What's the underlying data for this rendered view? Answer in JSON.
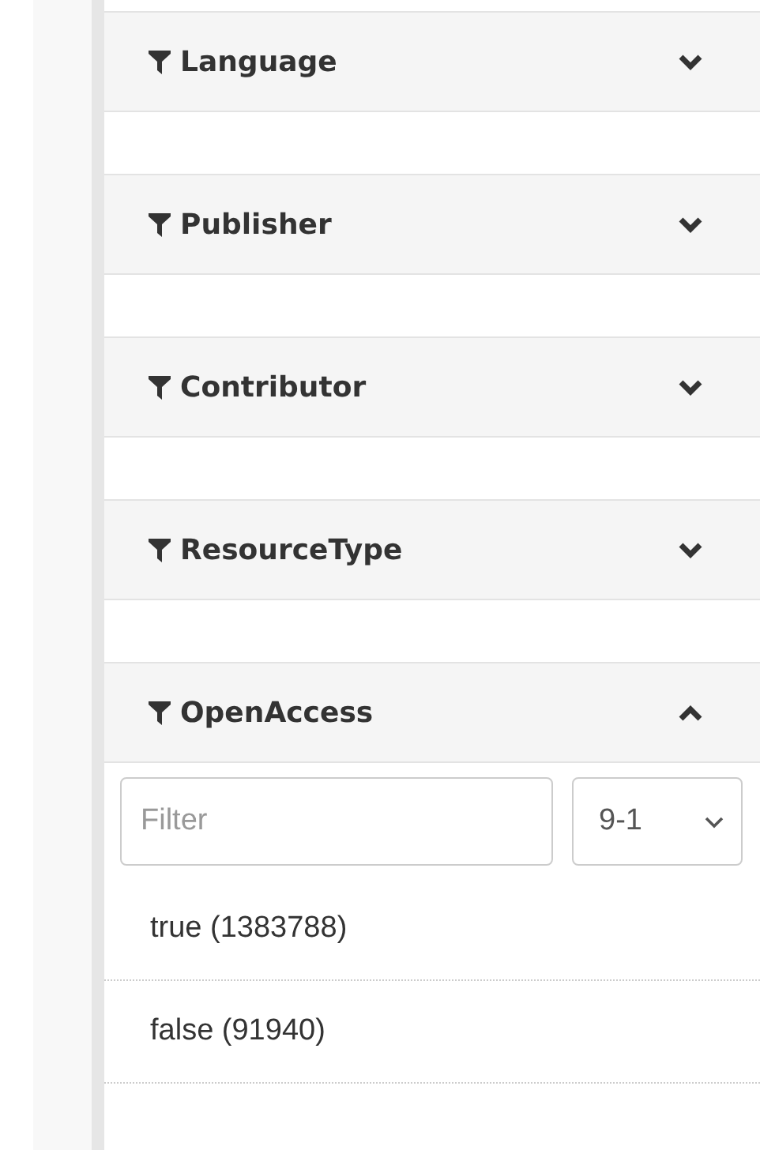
{
  "facets": [
    {
      "title": "Language",
      "expanded": false
    },
    {
      "title": "Publisher",
      "expanded": false
    },
    {
      "title": "Contributor",
      "expanded": false
    },
    {
      "title": "ResourceType",
      "expanded": false
    },
    {
      "title": "OpenAccess",
      "expanded": true,
      "filter": {
        "placeholder": "Filter"
      },
      "sort": "9-1",
      "items": [
        {
          "label": "true (1383788)"
        },
        {
          "label": "false (91940)"
        }
      ]
    }
  ]
}
